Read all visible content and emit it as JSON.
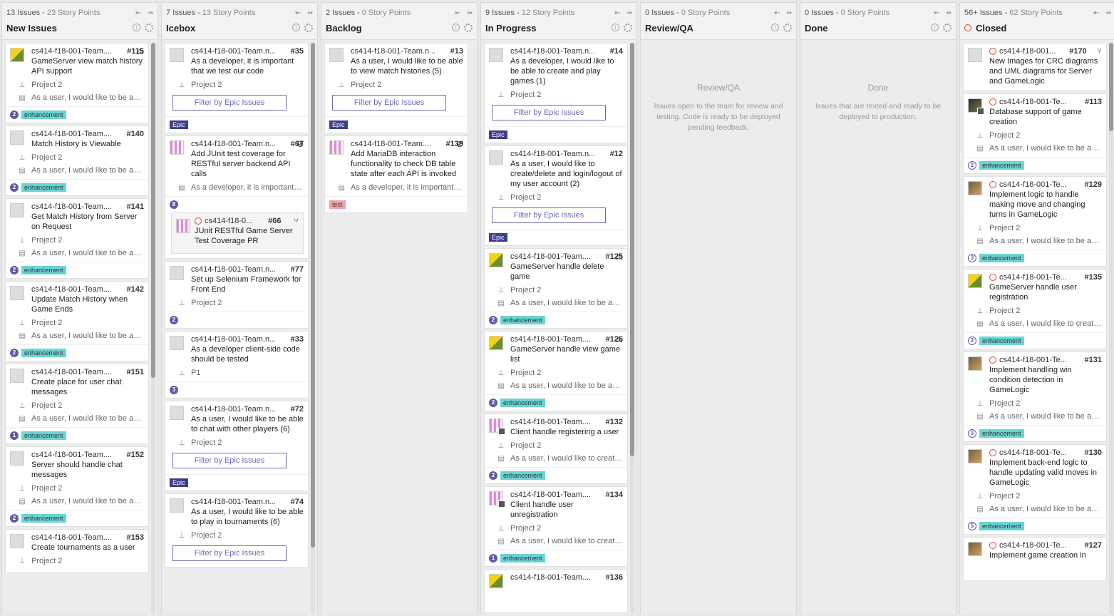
{
  "columns": [
    {
      "count": "13 Issues",
      "points": "23 Story Points",
      "name": "New Issues"
    },
    {
      "count": "7 Issues",
      "points": "13 Story Points",
      "name": "Icebox"
    },
    {
      "count": "2 Issues",
      "points": "0 Story Points",
      "name": "Backlog"
    },
    {
      "count": "9 Issues",
      "points": "12 Story Points",
      "name": "In Progress"
    },
    {
      "count": "0 Issues",
      "points": "0 Story Points",
      "name": "Review/QA",
      "empty_title": "Review/QA",
      "empty_desc": "Issues open to the team for review and testing. Code is ready to be deployed pending feedback."
    },
    {
      "count": "0 Issues",
      "points": "0 Story Points",
      "name": "Done",
      "empty_title": "Done",
      "empty_desc": "Issues that are tested and ready to be deployed to production."
    },
    {
      "count": "56+ Issues",
      "points": "62 Story Points",
      "name": "Closed"
    }
  ],
  "common": {
    "filter_label": "Filter by Epic Issues",
    "enhancement": "enhancement",
    "epic": "Epic",
    "test": "test"
  },
  "new_issues": [
    {
      "repo": "cs414-f18-001-Team....",
      "num": "#115",
      "title": "GameServer view match history API support",
      "milestone": "Project 2",
      "body": "As a user, I would like to be abl...",
      "points": "2"
    },
    {
      "repo": "cs414-f18-001-Team....",
      "num": "#140",
      "title": "Match History is Viewable",
      "milestone": "Project 2",
      "body": "As a user, I would like to be abl...",
      "points": "2"
    },
    {
      "repo": "cs414-f18-001-Team....",
      "num": "#141",
      "title": "Get Match History from Server on Request",
      "milestone": "Project 2",
      "body": "As a user, I would like to be abl...",
      "points": "2"
    },
    {
      "repo": "cs414-f18-001-Team....",
      "num": "#142",
      "title": "Update Match History when Game Ends",
      "milestone": "Project 2",
      "body": "As a user, I would like to be abl...",
      "points": "2"
    },
    {
      "repo": "cs414-f18-001-Team....",
      "num": "#151",
      "title": "Create place for user chat messages",
      "milestone": "Project 2",
      "body": "As a user, I would like to be abl...",
      "points": "1"
    },
    {
      "repo": "cs414-f18-001-Team....",
      "num": "#152",
      "title": "Server should handle chat messages",
      "milestone": "Project 2",
      "body": "As a user, I would like to be abl...",
      "points": "2"
    },
    {
      "repo": "cs414-f18-001-Team....",
      "num": "#153",
      "title": "Create tournaments as a user",
      "milestone": "Project 2"
    }
  ],
  "icebox": [
    {
      "repo": "cs414-f18-001-Team.n...",
      "num": "#35",
      "title": "As a developer, it is important that we test our code",
      "milestone": "Project 2"
    },
    {
      "repo": "cs414-f18-001-Team.n...",
      "num": "#67",
      "title": "Add JUnit test coverage for RESTful server backend API calls",
      "body": "As a developer, it is important t...",
      "points": "8",
      "sub_repo": "cs414-f18-0...",
      "sub_num": "#66",
      "sub_title": "JUnit RESTful Game Server Test Coverage PR"
    },
    {
      "repo": "cs414-f18-001-Team.n...",
      "num": "#77",
      "title": "Set up Selenium Framework for Front End",
      "milestone": "Project 2",
      "points": "2"
    },
    {
      "repo": "cs414-f18-001-Team.n...",
      "num": "#33",
      "title": "As a developer client-side code should be tested",
      "milestone": "P1",
      "points": "3"
    },
    {
      "repo": "cs414-f18-001-Team.n...",
      "num": "#72",
      "title": "As a user, I would like to be able to chat with other players (6)",
      "milestone": "Project 2"
    },
    {
      "repo": "cs414-f18-001-Team.n...",
      "num": "#74",
      "title": "As a user, I would like to be able to play in tournaments (6)",
      "milestone": "Project 2"
    }
  ],
  "backlog": [
    {
      "repo": "cs414-f18-001-Team.n...",
      "num": "#13",
      "title": "As a user, I would like to be able to view match histories (5)",
      "milestone": "Project 2"
    },
    {
      "repo": "cs414-f18-001-Team....",
      "num": "#139",
      "title": "Add MariaDB interaction functionality to check DB table state after each API is invoked",
      "body": "As a developer, it is important t..."
    }
  ],
  "in_progress": [
    {
      "repo": "cs414-f18-001-Team.n...",
      "num": "#14",
      "title": "As a developer, I would like to be able to create and play games (1)",
      "milestone": "Project 2"
    },
    {
      "repo": "cs414-f18-001-Team.n...",
      "num": "#12",
      "title": "As a user, I would like to create/delete and login/logout of my user account (2)",
      "milestone": "Project 2"
    },
    {
      "repo": "cs414-f18-001-Team....",
      "num": "#125",
      "title": "GameServer handle delete game",
      "milestone": "Project 2",
      "body": "As a user, I would like to be abl...",
      "points": "2"
    },
    {
      "repo": "cs414-f18-001-Team....",
      "num": "#126",
      "title": "GameServer handle view game list",
      "milestone": "Project 2",
      "body": "As a user, I would like to be abl...",
      "points": "2"
    },
    {
      "repo": "cs414-f18-001-Team....",
      "num": "#132",
      "title": "Client handle registering a user",
      "milestone": "Project 2",
      "body": "As a user, I would like to create/...",
      "points": "2"
    },
    {
      "repo": "cs414-f18-001-Team....",
      "num": "#134",
      "title": "Client handle user unregistration",
      "milestone": "Project 2",
      "body": "As a user, I would like to create/...",
      "points": "1"
    },
    {
      "repo": "cs414-f18-001-Team....",
      "num": "#136"
    }
  ],
  "closed": [
    {
      "repo": "cs414-f18-001...",
      "num": "#170",
      "title": "New Images for CRC diagrams and UML diagrams for Server and GameLogic"
    },
    {
      "repo": "cs414-f18-001-Te...",
      "num": "#113",
      "title": "Database support of game creation",
      "milestone": "Project 2",
      "body": "As a user, I would like to be abl...",
      "points": "2"
    },
    {
      "repo": "cs414-f18-001-Te...",
      "num": "#129",
      "title": "Implement logic to handle making move and changing turns in GameLogic",
      "milestone": "Project 2",
      "body": "As a user, I would like to be abl...",
      "points": "3"
    },
    {
      "repo": "cs414-f18-001-Te...",
      "num": "#135",
      "title": "GameServer handle user registration",
      "milestone": "Project 2",
      "body": "As a user, I would like to create/...",
      "points": "2"
    },
    {
      "repo": "cs414-f18-001-Te...",
      "num": "#131",
      "title": "Implement handling win condition detection in GameLogic",
      "milestone": "Project 2",
      "body": "As a user, I would like to be abl...",
      "points": "3"
    },
    {
      "repo": "cs414-f18-001-Te...",
      "num": "#130",
      "title": "Implement back-end logic to handle updating valid moves in GameLogic",
      "milestone": "Project 2",
      "body": "As a user, I would like to be abl...",
      "points": "5"
    },
    {
      "repo": "cs414-f18-001-Te...",
      "num": "#127",
      "title": "Implement game creation in"
    }
  ]
}
